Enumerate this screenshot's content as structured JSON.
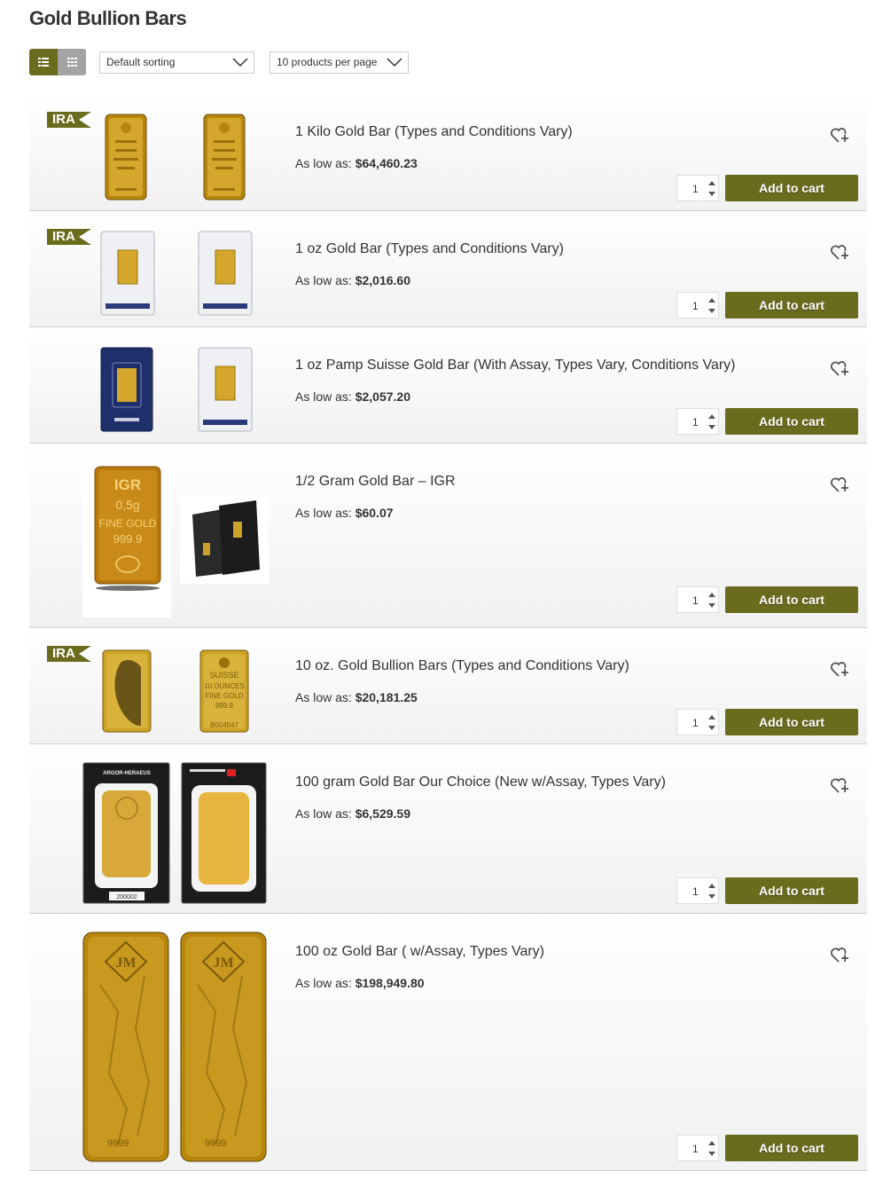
{
  "page": {
    "title": "Gold Bullion Bars"
  },
  "toolbar": {
    "sort_value": "Default sorting",
    "per_page_value": "10 products per page"
  },
  "colors": {
    "accent": "#6b6b1e",
    "gold": "#c9a227",
    "inactive": "#a3a3a3"
  },
  "common": {
    "price_prefix": "As low as:",
    "add_to_cart": "Add to cart",
    "ira_label": "IRA"
  },
  "products": [
    {
      "title": "1 Kilo Gold Bar (Types and Conditions Vary)",
      "price": "$64,460.23",
      "qty": "1",
      "ira": true
    },
    {
      "title": "1 oz Gold Bar (Types and Conditions Vary)",
      "price": "$2,016.60",
      "qty": "1",
      "ira": true
    },
    {
      "title": "1 oz Pamp Suisse Gold Bar (With Assay, Types Vary, Conditions Vary)",
      "price": "$2,057.20",
      "qty": "1",
      "ira": false
    },
    {
      "title": "1/2 Gram Gold Bar – IGR",
      "price": "$60.07",
      "qty": "1",
      "ira": false,
      "image_text": {
        "brand": "IGR",
        "weight": "0,5g",
        "line1": "FINE GOLD",
        "purity": "999.9"
      }
    },
    {
      "title": "10 oz. Gold Bullion Bars (Types and Conditions Vary)",
      "price": "$20,181.25",
      "qty": "1",
      "ira": true,
      "image_text": {
        "brand": "SUISSE",
        "weight": "10 OUNCES",
        "line1": "FINE GOLD",
        "purity": "999.9",
        "serial": "B004547"
      }
    },
    {
      "title": "100 gram Gold Bar Our Choice (New w/Assay, Types Vary)",
      "price": "$6,529.59",
      "qty": "1",
      "ira": false,
      "image_text": {
        "brand": "ARGOR-HERAEUS",
        "serial": "200002"
      }
    },
    {
      "title": "100 oz Gold Bar ( w/Assay, Types Vary)",
      "price": "$198,949.80",
      "qty": "1",
      "ira": false,
      "image_text": {
        "brand": "JM",
        "purity": "9999"
      }
    }
  ]
}
